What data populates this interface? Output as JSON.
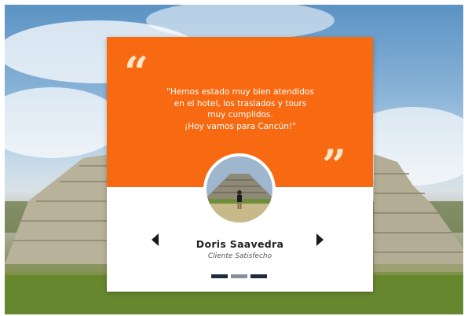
{
  "testimonial": {
    "quote_lines": [
      "\"Hemos estado muy bien atendidos",
      "en el hotel, los traslados y tours",
      "muy cumplidos.",
      "¡Hoy vamos para Cancún!\""
    ],
    "author_name": "Doris Saavedra",
    "author_role": "Cliente Satisfecho",
    "open_quote_glyph": "“",
    "close_quote_glyph": "”"
  },
  "carousel": {
    "slide_count": 3,
    "active_index": 1
  },
  "colors": {
    "card_accent": "#f86a12",
    "quote_mark": "#fde6c8",
    "dot": "#1f2a3c",
    "dot_active": "#8a8f99"
  },
  "icons": {
    "prev": "triangle-left-icon",
    "next": "triangle-right-icon"
  }
}
